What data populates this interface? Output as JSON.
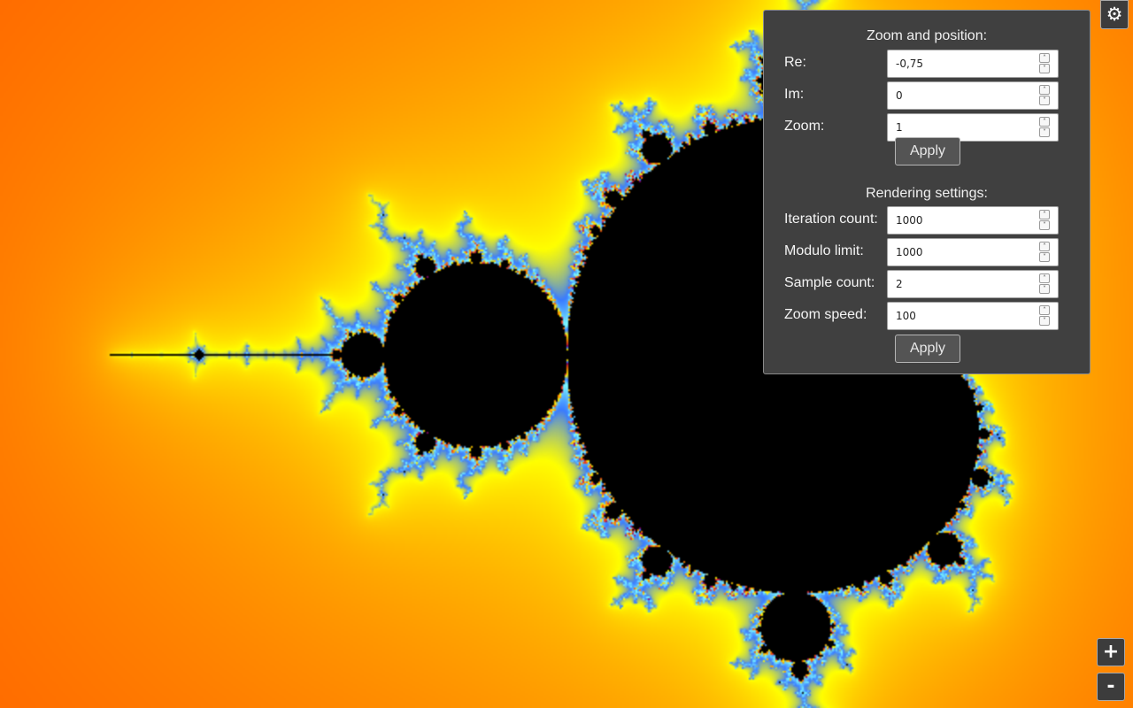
{
  "panel": {
    "position_section": {
      "title": "Zoom and position:",
      "fields": [
        {
          "label": "Re:",
          "value": "-0,75"
        },
        {
          "label": "Im:",
          "value": "0"
        },
        {
          "label": "Zoom:",
          "value": "1"
        }
      ],
      "apply_label": "Apply"
    },
    "rendering_section": {
      "title": "Rendering settings:",
      "fields": [
        {
          "label": "Iteration count:",
          "value": "1000"
        },
        {
          "label": "Modulo limit:",
          "value": "1000"
        },
        {
          "label": "Sample count:",
          "value": "2"
        },
        {
          "label": "Zoom speed:",
          "value": "100"
        }
      ],
      "apply_label": "Apply"
    }
  },
  "controls": {
    "settings_icon": "gear-icon",
    "settings_glyph": "⚙",
    "zoom_in_label": "+",
    "zoom_out_label": "-"
  },
  "view": {
    "re": -0.75,
    "im": 0,
    "zoom": 1,
    "iterations": 1000,
    "colors": [
      "#800080",
      "#e2312a",
      "#ff6a00",
      "#ffb300",
      "#ffff00",
      "#3a7bff",
      "#7fffff"
    ],
    "set_color": "#000000"
  }
}
